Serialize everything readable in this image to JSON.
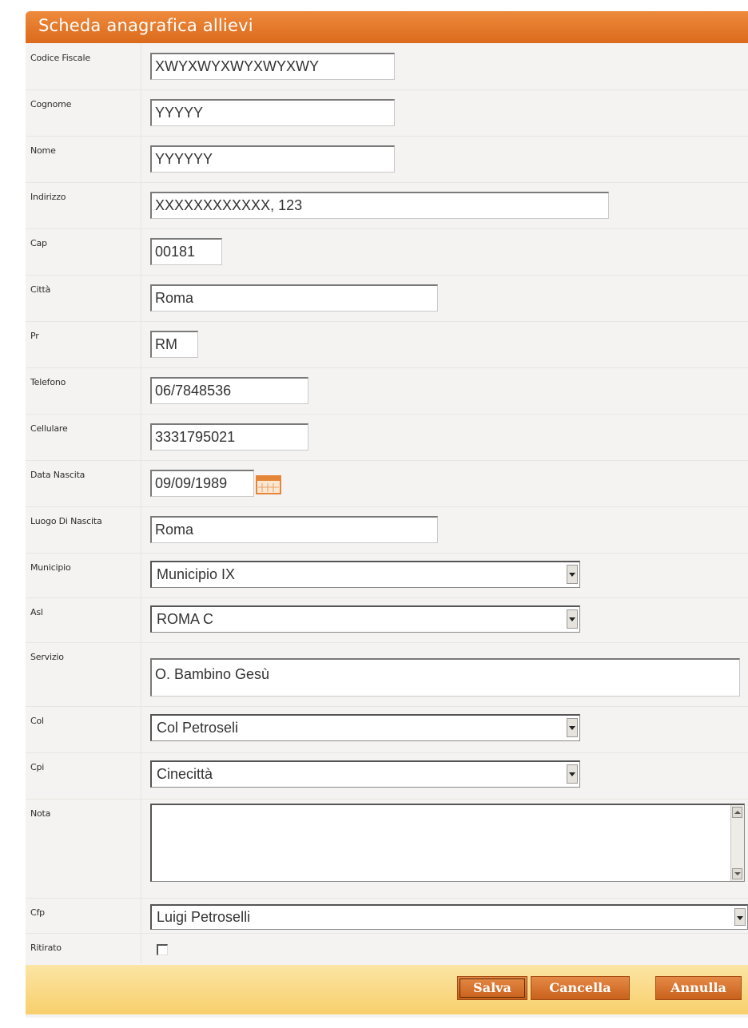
{
  "form": {
    "title": "Scheda anagrafica allievi",
    "fields": [
      {
        "label": "Codice Fiscale",
        "value": "XWYXWYXWYXWYXWY"
      },
      {
        "label": "Cognome",
        "value": "YYYYY"
      },
      {
        "label": "Nome",
        "value": "YYYYYY"
      },
      {
        "label": "Indirizzo",
        "value": "XXXXXXXXXXXX, 123"
      },
      {
        "label": "Cap",
        "value": "00181"
      },
      {
        "label": "Città",
        "value": "Roma"
      },
      {
        "label": "Pr",
        "value": "RM"
      },
      {
        "label": "Telefono",
        "value": "06/7848536"
      },
      {
        "label": "Cellulare",
        "value": "3331795021"
      },
      {
        "label": "Data Nascita",
        "value": "09/09/1989"
      },
      {
        "label": "Luogo Di Nascita",
        "value": "Roma"
      },
      {
        "label": "Municipio",
        "value": "Municipio IX"
      },
      {
        "label": "Asl",
        "value": "ROMA C"
      },
      {
        "label": "Servizio",
        "value": "O. Bambino Gesù"
      },
      {
        "label": "Col",
        "value": "Col Petroseli"
      },
      {
        "label": "Cpi",
        "value": "Cinecittà"
      },
      {
        "label": "Nota",
        "value": ""
      },
      {
        "label": "Cfp",
        "value": "Luigi Petroselli"
      },
      {
        "label": "Ritirato",
        "checked": false
      }
    ]
  },
  "buttons": {
    "save": "Salva",
    "delete": "Cancella",
    "cancel": "Annulla"
  },
  "icons": {
    "date_picker": "calendar-icon",
    "select_arrow": "chevron-down-icon"
  },
  "colors": {
    "title_bar": "#e37a2c",
    "button_bar": "#f9d57c",
    "button": "#d46e28",
    "panel_bg": "#f4f3f1"
  }
}
